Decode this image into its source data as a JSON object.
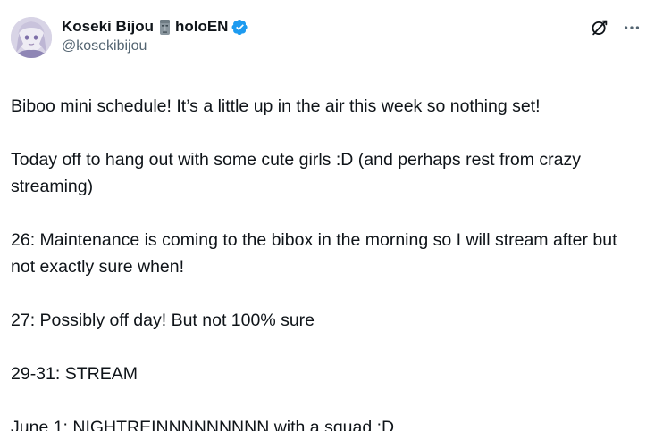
{
  "author": {
    "display_name": "Koseki Bijou",
    "org_tag": "holoEN",
    "handle": "@kosekibijou",
    "name_emoji": "moai-icon",
    "verified_color": "#1d9bf0"
  },
  "post": {
    "paragraphs": [
      "Biboo mini schedule! It’s a little up in the air this week so nothing set!",
      "Today off to hang out with some cute girls :D (and perhaps rest from crazy streaming)",
      "26: Maintenance is coming to the bibox in the morning so I will stream after but not exactly sure when!",
      "27: Possibly off day! But not 100% sure",
      "29-31: STREAM",
      "June 1: NIGHTREINNNNNNNNN with a squad :D"
    ]
  },
  "icons": {
    "grok": "grok-icon",
    "more": "more-options-icon"
  }
}
